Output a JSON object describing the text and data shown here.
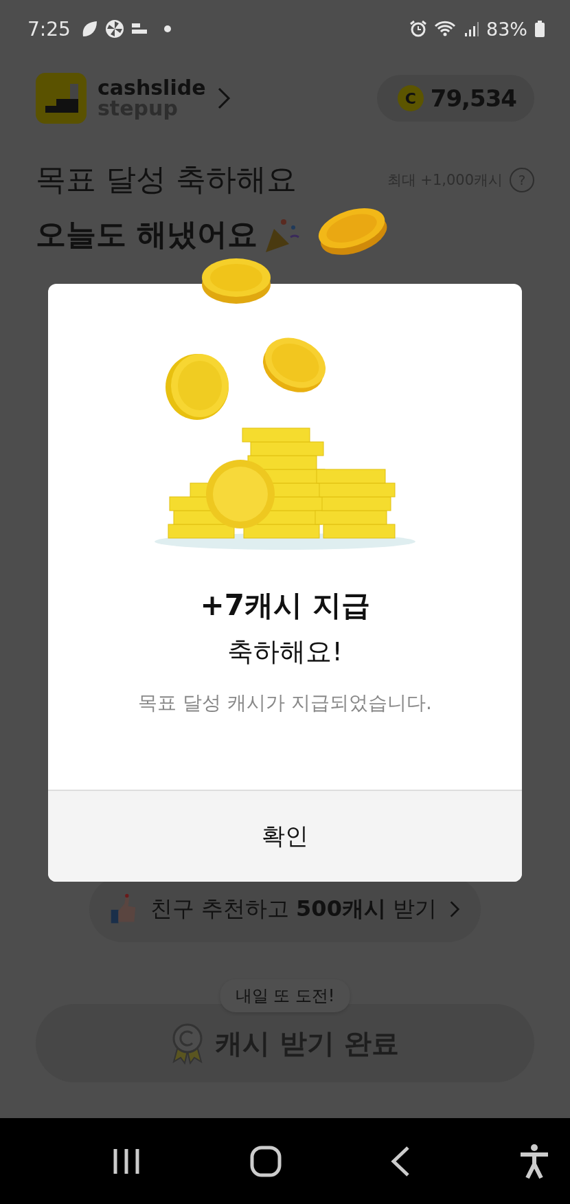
{
  "status_bar": {
    "time": "7:25",
    "battery": "83%"
  },
  "header": {
    "brand_line1": "cashslide",
    "brand_line2": "stepup",
    "coin_letter": "C",
    "balance": "79,534"
  },
  "heading": {
    "title": "목표 달성 축하해요",
    "subtitle": "오늘도 해냈어요",
    "max_reward": "최대 +1,000캐시",
    "help": "?"
  },
  "dialog": {
    "title": "+7캐시 지급",
    "subtitle": "축하해요!",
    "message": "목표 달성 캐시가 지급되었습니다.",
    "confirm": "확인"
  },
  "referral": {
    "label": "친구 추천하고 **500캐시** 받기"
  },
  "tooltip": "내일 또 도전!",
  "complete_button": {
    "label": "캐시 받기 완료",
    "disabled": true
  }
}
